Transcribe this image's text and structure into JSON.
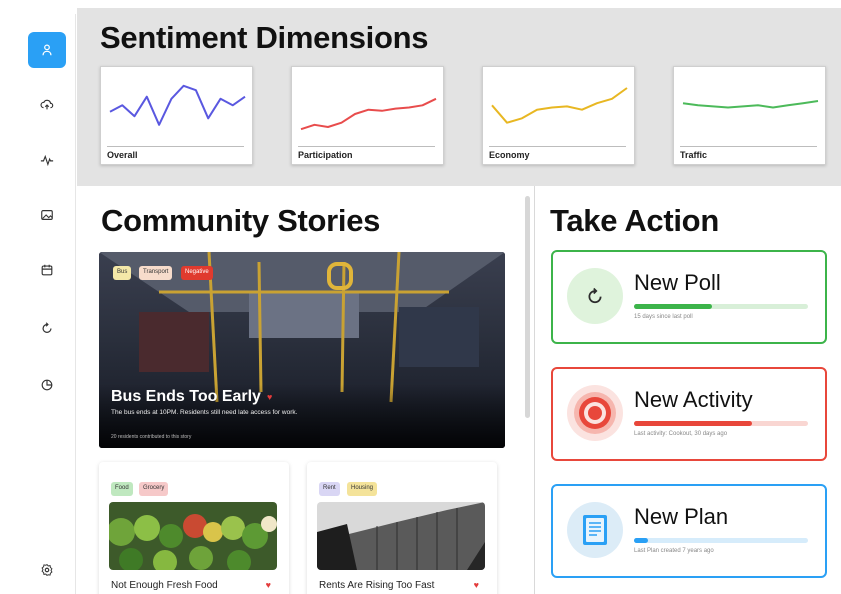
{
  "sidebar": {
    "items": [
      {
        "name": "person-icon",
        "active": true
      },
      {
        "name": "cloud-upload-icon",
        "active": false
      },
      {
        "name": "activity-icon",
        "active": false
      },
      {
        "name": "image-icon",
        "active": false
      },
      {
        "name": "calendar-icon",
        "active": false
      },
      {
        "name": "refresh-icon",
        "active": false
      },
      {
        "name": "pie-chart-icon",
        "active": false
      },
      {
        "name": "settings-icon",
        "active": false
      }
    ],
    "accent": "#2aa0f5"
  },
  "dimensions": {
    "title": "Sentiment Dimensions",
    "cards": [
      {
        "label": "Overall",
        "color": "#5a58e0",
        "values": [
          46,
          52,
          42,
          60,
          34,
          58,
          70,
          66,
          40,
          58,
          52,
          60
        ]
      },
      {
        "label": "Participation",
        "color": "#e84c4c",
        "values": [
          30,
          34,
          32,
          36,
          44,
          48,
          47,
          49,
          50,
          52,
          58
        ]
      },
      {
        "label": "Economy",
        "color": "#e8b722",
        "values": [
          52,
          36,
          40,
          48,
          50,
          51,
          48,
          54,
          58,
          68
        ]
      },
      {
        "label": "Traffic",
        "color": "#4cba5a",
        "values": [
          54,
          52,
          51,
          50,
          51,
          52,
          50,
          52,
          54,
          56
        ]
      }
    ]
  },
  "stories": {
    "title": "Community Stories",
    "featured": {
      "tags": [
        {
          "text": "Bus",
          "color": "#f4e8a8"
        },
        {
          "text": "Transport",
          "color": "#f7dccb"
        },
        {
          "text": "Negative",
          "color": "#e03a2e"
        }
      ],
      "title": "Bus Ends Too Early",
      "heart": "♥",
      "description": "The bus ends at 10PM. Residents still need late access for work.",
      "meta": "20 residents contributed to this story"
    },
    "cards": [
      {
        "tags": [
          {
            "text": "Food",
            "color": "#bfe8bf"
          },
          {
            "text": "Grocery",
            "color": "#f6c9c9"
          }
        ],
        "title": "Not Enough Fresh Food",
        "heart": "♥"
      },
      {
        "tags": [
          {
            "text": "Rent",
            "color": "#d9d6f4"
          },
          {
            "text": "Housing",
            "color": "#f4e39a"
          }
        ],
        "title": "Rents Are Rising Too Fast",
        "heart": "♥"
      }
    ]
  },
  "actions": {
    "title": "Take Action",
    "items": [
      {
        "title": "New Poll",
        "subtitle": "15 days since last poll",
        "color": "#3cb44a",
        "track": "#d8efd8",
        "icon_bg": "#dff3dc",
        "progress": 0.45,
        "icon": "refresh-icon"
      },
      {
        "title": "New Activity",
        "subtitle": "Last activity: Cookout, 30 days ago",
        "color": "#e8473b",
        "track": "#f9d6d2",
        "icon_bg": "#fbe3e0",
        "progress": 0.68,
        "icon": "target-icon"
      },
      {
        "title": "New Plan",
        "subtitle": "Last Plan created 7 years ago",
        "color": "#2aa0f5",
        "track": "#d6ecfb",
        "icon_bg": "#dcecf7",
        "progress": 0.08,
        "icon": "document-icon"
      }
    ]
  }
}
